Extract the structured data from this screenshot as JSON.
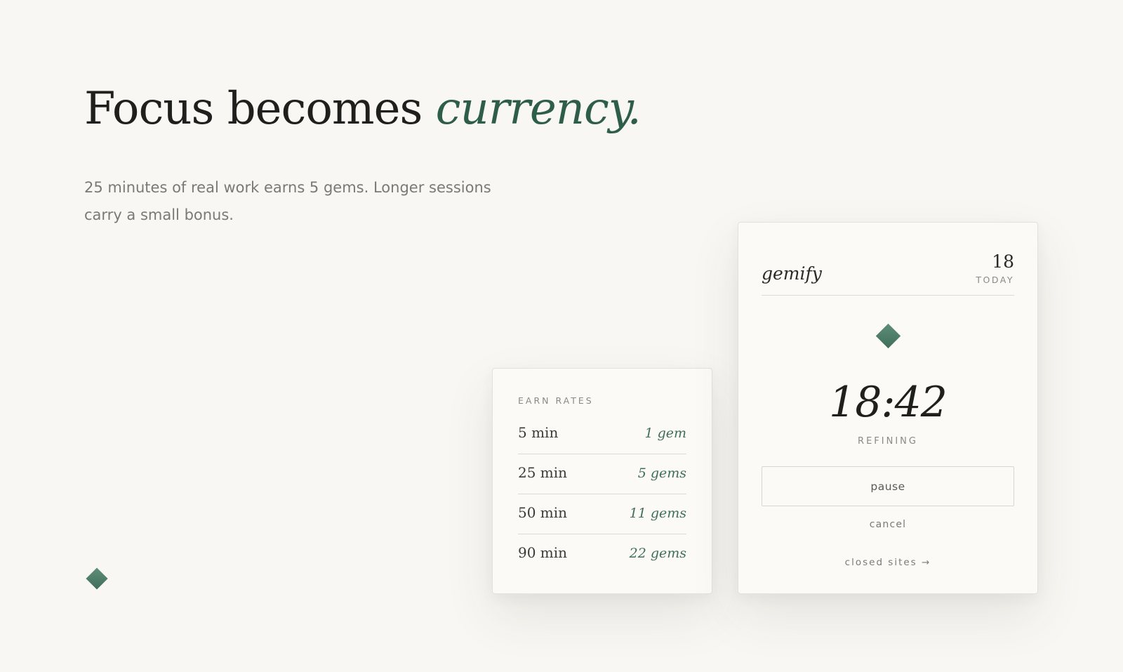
{
  "hero": {
    "headline_main": "Focus becomes ",
    "headline_accent": "currency.",
    "subcopy": "25 minutes of real work earns 5 gems. Longer sessions carry a small bonus."
  },
  "rates": {
    "title": "EARN RATES",
    "rows": [
      {
        "duration": "5 min",
        "reward": "1 gem"
      },
      {
        "duration": "25 min",
        "reward": "5 gems"
      },
      {
        "duration": "50 min",
        "reward": "11 gems"
      },
      {
        "duration": "90 min",
        "reward": "22 gems"
      }
    ]
  },
  "timer": {
    "brand": "gemify",
    "today_count": "18",
    "today_label": "TODAY",
    "time": "18:42",
    "status": "REFINING",
    "pause_label": "pause",
    "cancel_label": "cancel",
    "closed_sites_label": "closed sites →"
  },
  "colors": {
    "accent": "#3f6f5a",
    "background": "#f8f7f3",
    "card": "#fbfaf6"
  },
  "icons": {
    "gem": "gem-icon"
  }
}
